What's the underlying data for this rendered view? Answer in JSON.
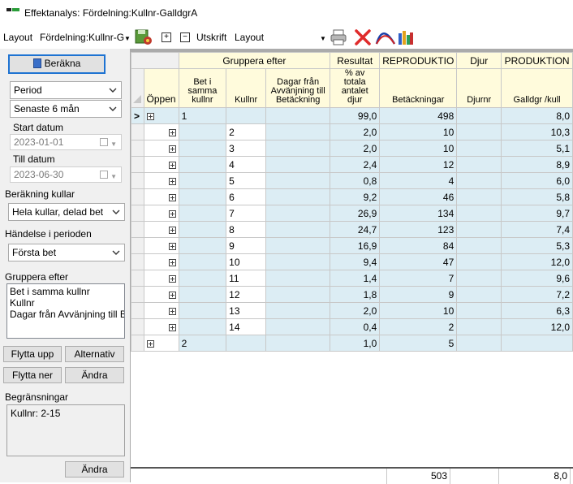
{
  "window": {
    "title": "Effektanalys: Fördelning:Kullnr-GalldgrA"
  },
  "toolbar": {
    "layout_label": "Layout",
    "layout_dropdown": "Fördelning:Kullnr-G",
    "print_label": "Utskrift",
    "print_layout_value": "Layout"
  },
  "sidebar": {
    "calculate_button": "Beräkna",
    "period_select": "Period",
    "range_select": "Senaste 6 mån",
    "start_label": "Start datum",
    "start_value": "2023-01-01",
    "end_label": "Till datum",
    "end_value": "2023-06-30",
    "litter_calc_label": "Beräkning kullar",
    "litter_calc_value": "Hela kullar, delad bet",
    "event_label": "Händelse i perioden",
    "event_value": "Första bet",
    "group_label": "Gruppera efter",
    "group_items": [
      "Bet i samma kullnr",
      "Kullnr",
      "Dagar från Avvänjning till Betäckning"
    ],
    "move_up": "Flytta upp",
    "alternative": "Alternativ",
    "move_down": "Flytta ner",
    "change": "Ändra",
    "limits_label": "Begränsningar",
    "limits_value": "Kullnr: 2-15",
    "change_bottom": "Ändra"
  },
  "grid": {
    "group_header": "Gruppera efter",
    "result_header": "Resultat",
    "repro_header": "REPRODUKTIO",
    "djur_header": "Djur",
    "prod_header": "PRODUKTION",
    "col_open": "Öppen",
    "col_bet": "Bet i samma kullnr",
    "col_kullnr": "Kullnr",
    "col_dagar": "Dagar från Avvänjning till Betäckning",
    "col_pct": "% av totala antalet djur",
    "col_bet_count": "Betäckningar",
    "col_djurnr": "Djurnr",
    "col_galldgr": "Galldgr /kull",
    "rows": [
      {
        "bet": "1",
        "kullnr": "",
        "pct": "99,0",
        "bet_count": "498",
        "galldgr": "8,0",
        "level": 0,
        "selected": true
      },
      {
        "bet": "",
        "kullnr": "2",
        "pct": "2,0",
        "bet_count": "10",
        "galldgr": "10,3",
        "level": 1
      },
      {
        "bet": "",
        "kullnr": "3",
        "pct": "2,0",
        "bet_count": "10",
        "galldgr": "5,1",
        "level": 1
      },
      {
        "bet": "",
        "kullnr": "4",
        "pct": "2,4",
        "bet_count": "12",
        "galldgr": "8,9",
        "level": 1
      },
      {
        "bet": "",
        "kullnr": "5",
        "pct": "0,8",
        "bet_count": "4",
        "galldgr": "6,0",
        "level": 1
      },
      {
        "bet": "",
        "kullnr": "6",
        "pct": "9,2",
        "bet_count": "46",
        "galldgr": "5,8",
        "level": 1
      },
      {
        "bet": "",
        "kullnr": "7",
        "pct": "26,9",
        "bet_count": "134",
        "galldgr": "9,7",
        "level": 1
      },
      {
        "bet": "",
        "kullnr": "8",
        "pct": "24,7",
        "bet_count": "123",
        "galldgr": "7,4",
        "level": 1
      },
      {
        "bet": "",
        "kullnr": "9",
        "pct": "16,9",
        "bet_count": "84",
        "galldgr": "5,3",
        "level": 1
      },
      {
        "bet": "",
        "kullnr": "10",
        "pct": "9,4",
        "bet_count": "47",
        "galldgr": "12,0",
        "level": 1
      },
      {
        "bet": "",
        "kullnr": "11",
        "pct": "1,4",
        "bet_count": "7",
        "galldgr": "9,6",
        "level": 1
      },
      {
        "bet": "",
        "kullnr": "12",
        "pct": "1,8",
        "bet_count": "9",
        "galldgr": "7,2",
        "level": 1
      },
      {
        "bet": "",
        "kullnr": "13",
        "pct": "2,0",
        "bet_count": "10",
        "galldgr": "6,3",
        "level": 1
      },
      {
        "bet": "",
        "kullnr": "14",
        "pct": "0,4",
        "bet_count": "2",
        "galldgr": "12,0",
        "level": 1
      },
      {
        "bet": "2",
        "kullnr": "",
        "pct": "1,0",
        "bet_count": "5",
        "galldgr": "",
        "level": 0
      }
    ],
    "footer_bet_count": "503",
    "footer_galldgr": "8,0"
  }
}
